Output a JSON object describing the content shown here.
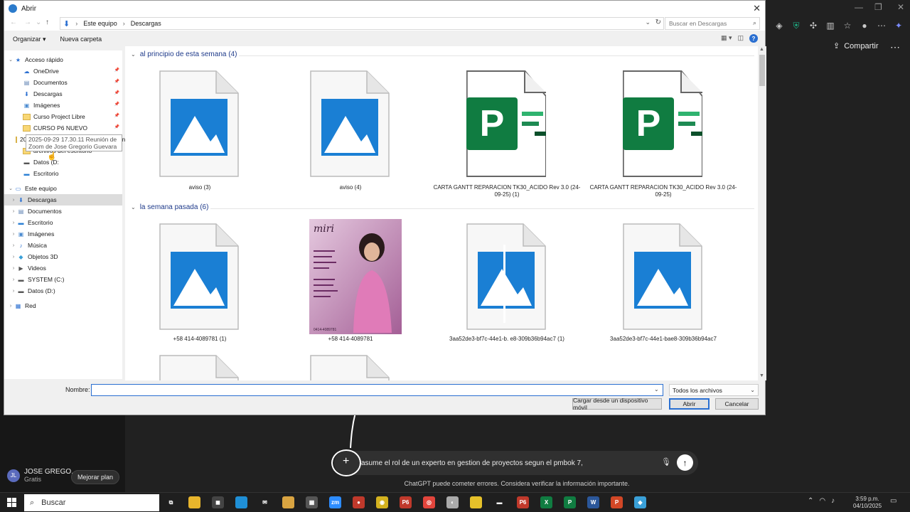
{
  "dialog": {
    "title": "Abrir",
    "breadcrumb": [
      "Este equipo",
      "Descargas"
    ],
    "search_placeholder": "Buscar en Descargas",
    "organize_label": "Organizar",
    "new_folder_label": "Nueva carpeta",
    "filename_label": "Nombre:",
    "filename_value": "",
    "filter_value": "Todos los archivos",
    "mobile_button": "Cargar desde un dispositivo móvil",
    "open_button": "Abrir",
    "cancel_button": "Cancelar"
  },
  "nav": {
    "quick_access": "Acceso rápido",
    "quick_items": [
      {
        "label": "OneDrive",
        "icon": "cloud-icon"
      },
      {
        "label": "Documentos",
        "icon": "document-icon"
      },
      {
        "label": "Descargas",
        "icon": "download-icon"
      },
      {
        "label": "Imágenes",
        "icon": "image-icon"
      },
      {
        "label": "Curso Project Libre",
        "icon": "folder-icon"
      },
      {
        "label": "CURSO P6 NUEVO",
        "icon": "folder-icon"
      },
      {
        "label": "2025-09-29 17.30.11 Reunión de Zoom",
        "icon": "folder-icon"
      },
      {
        "label": "archivos del escritorio",
        "icon": "folder-icon"
      },
      {
        "label": "Datos (D:",
        "icon": "drive-icon"
      },
      {
        "label": "Escritorio",
        "icon": "desktop-icon"
      }
    ],
    "tooltip": "2025-09-29 17.30.11 Reunión de Zoom de Jose Gregorio Guevara",
    "this_pc": "Este equipo",
    "pc_items": [
      {
        "label": "Descargas",
        "icon": "download-icon"
      },
      {
        "label": "Documentos",
        "icon": "document-icon"
      },
      {
        "label": "Escritorio",
        "icon": "desktop-icon"
      },
      {
        "label": "Imágenes",
        "icon": "image-icon"
      },
      {
        "label": "Música",
        "icon": "music-icon"
      },
      {
        "label": "Objetos 3D",
        "icon": "cube-icon"
      },
      {
        "label": "Videos",
        "icon": "video-icon"
      },
      {
        "label": "SYSTEM (C:)",
        "icon": "drive-icon"
      },
      {
        "label": "Datos (D:)",
        "icon": "drive-icon"
      }
    ],
    "network": "Red"
  },
  "groups": [
    {
      "header": "al principio de esta semana (4)",
      "files": [
        {
          "name": "aviso (3)",
          "type": "image"
        },
        {
          "name": "aviso (4)",
          "type": "image"
        },
        {
          "name": "CARTA GANTT REPARACION TK30_ACIDO Rev 3.0 (24-09-25) (1)",
          "type": "project"
        },
        {
          "name": "CARTA GANTT REPARACION TK30_ACIDO Rev 3.0 (24-09-25)",
          "type": "project"
        }
      ]
    },
    {
      "header": "la semana pasada (6)",
      "files": [
        {
          "name": "+58 414-4089781 (1)",
          "type": "image"
        },
        {
          "name": "+58 414-4089781",
          "type": "photo"
        },
        {
          "name": "3aa52de3-bf7c-44e1-b. e8-309b36b94ac7 (1)",
          "type": "image"
        },
        {
          "name": "3aa52de3-bf7c-44e1-bae8-309b36b94ac7",
          "type": "image"
        }
      ]
    }
  ],
  "photo_text": {
    "brand": "miri",
    "phone": "0414-4089781"
  },
  "chatgpt": {
    "share": "Compartir",
    "user_name": "JOSE GREGO...",
    "user_initials": "JL",
    "user_plan": "Gratis",
    "upgrade": "Mejorar plan",
    "prompt": "asume el rol de un experto en gestion de proyectos segun el pmbok 7,",
    "disclaimer": "ChatGPT puede cometer errores. Considera verificar la información importante."
  },
  "taskbar": {
    "search": "Buscar",
    "time": "3:59 p.m.",
    "date": "04/10/2025",
    "pinned_labels": [
      "zm",
      "P6",
      "P6",
      "X",
      "P",
      "W",
      "P"
    ]
  },
  "colors": {
    "accent": "#2a6fd1",
    "project_green": "#107c41",
    "image_blue": "#1a7fd4"
  }
}
